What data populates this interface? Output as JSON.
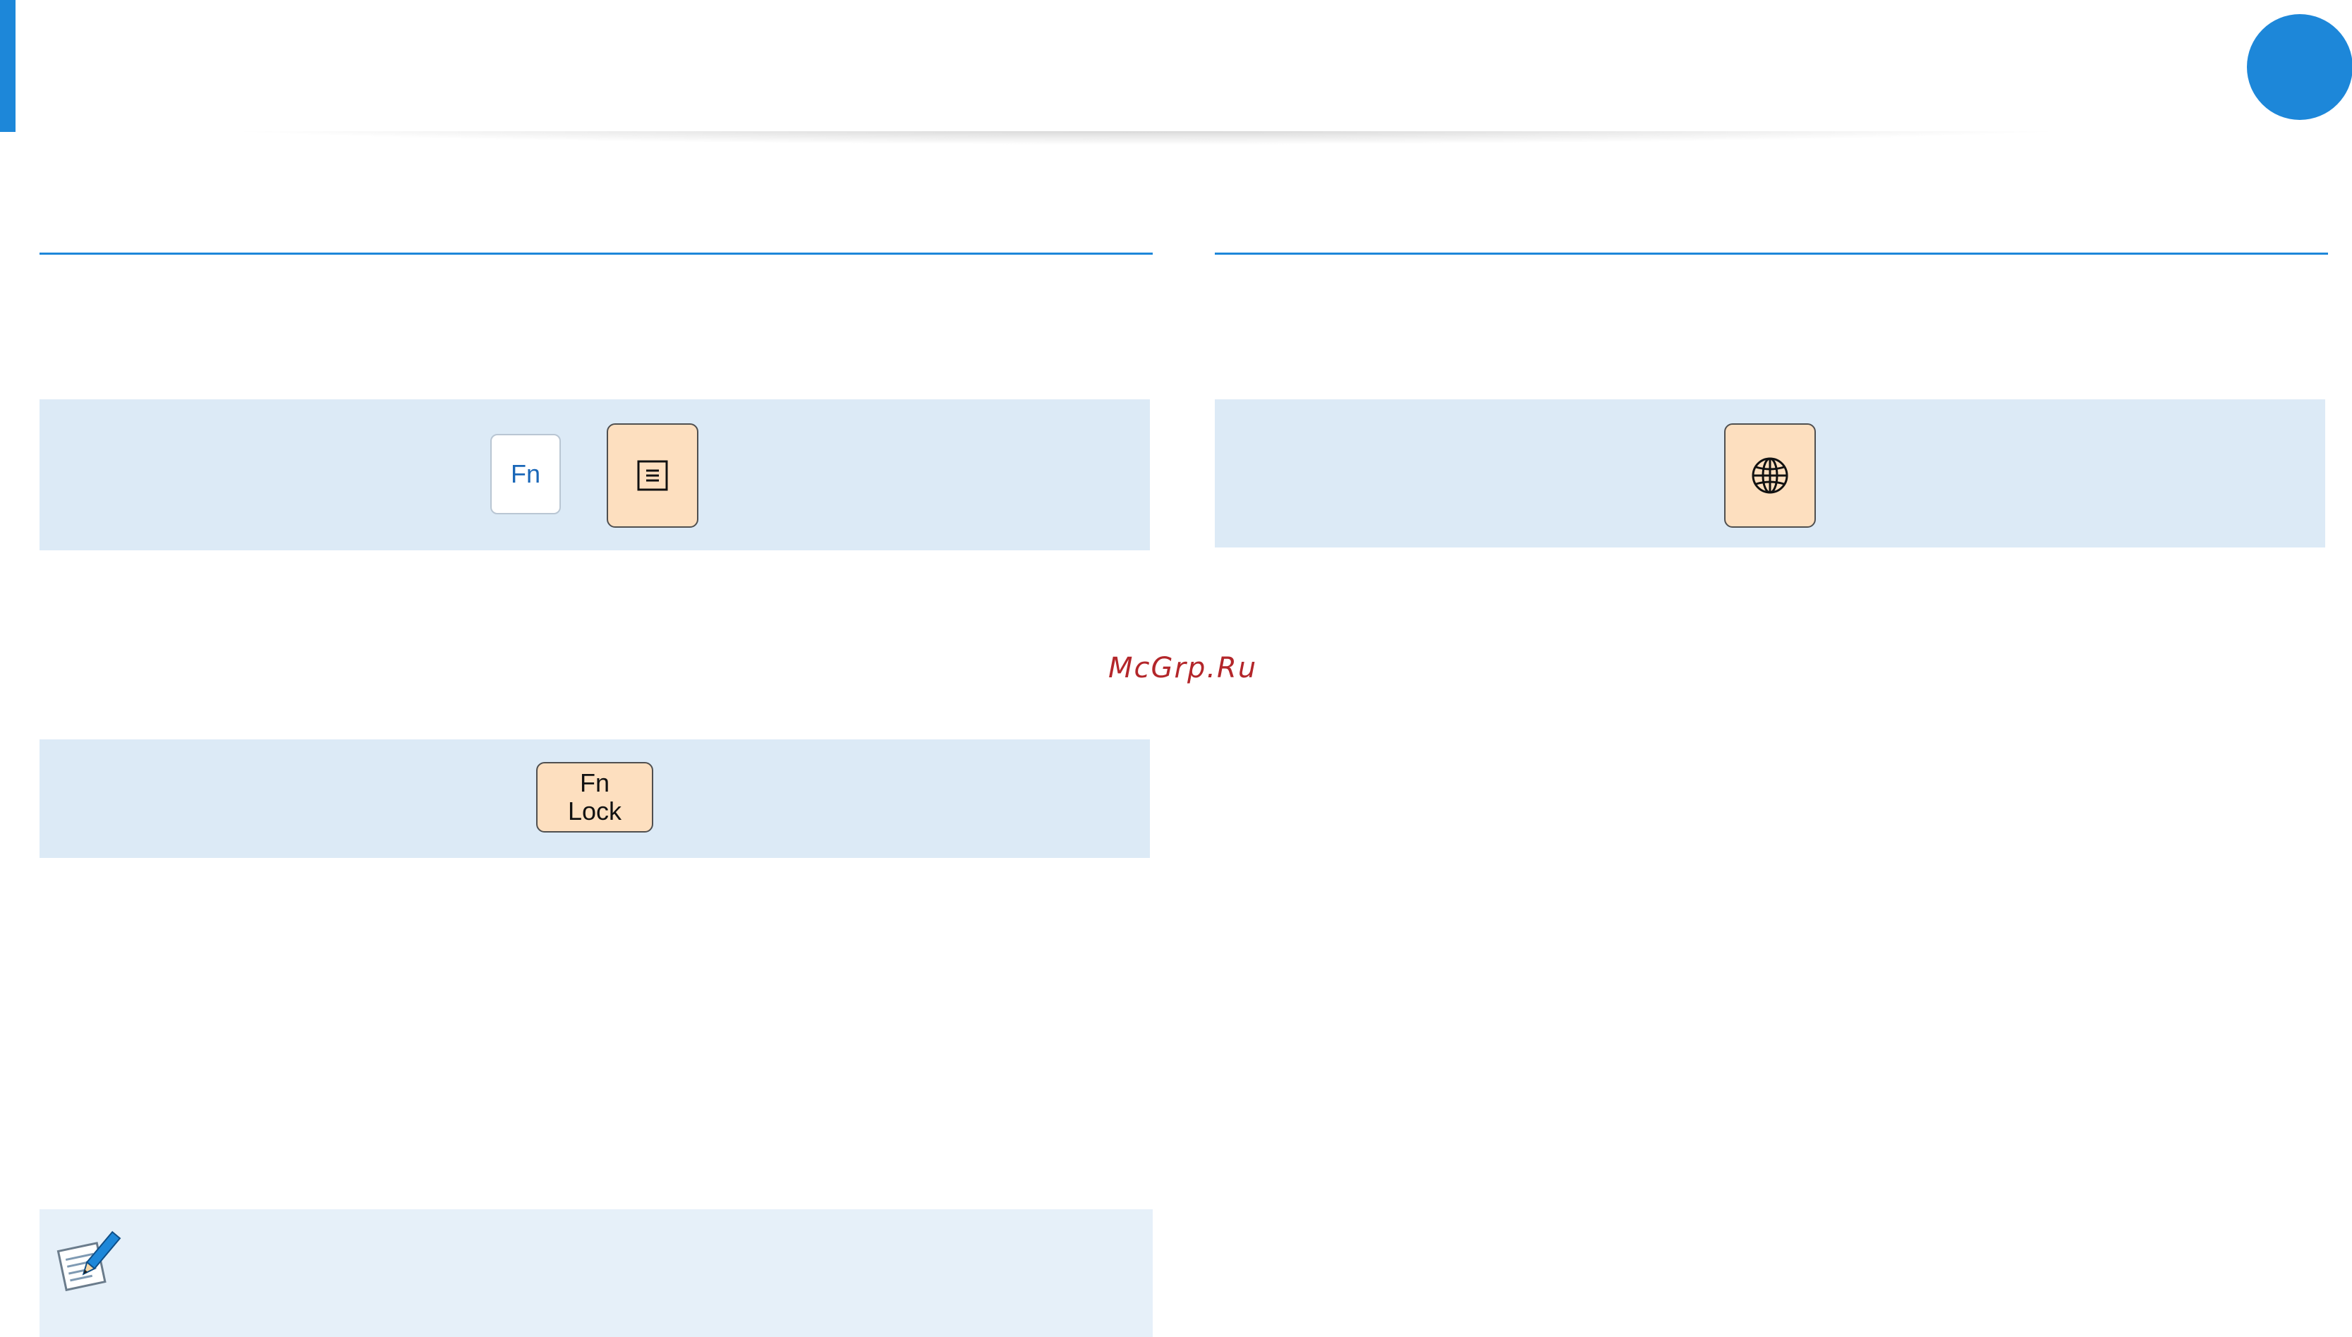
{
  "colors": {
    "accent": "#1d87d9",
    "panel": "#dceaf6",
    "note_panel": "#e6f0f9",
    "key_fill": "#fddfbf",
    "fn_text": "#1a67b8",
    "watermark": "#b3262a"
  },
  "keys": {
    "fn_label": "Fn",
    "menu_icon": "menu-key-icon",
    "globe_icon": "globe-icon",
    "fn_lock_line1": "Fn",
    "fn_lock_line2": "Lock"
  },
  "watermark": "McGrp.Ru",
  "note": {
    "icon": "note-pencil-icon"
  }
}
